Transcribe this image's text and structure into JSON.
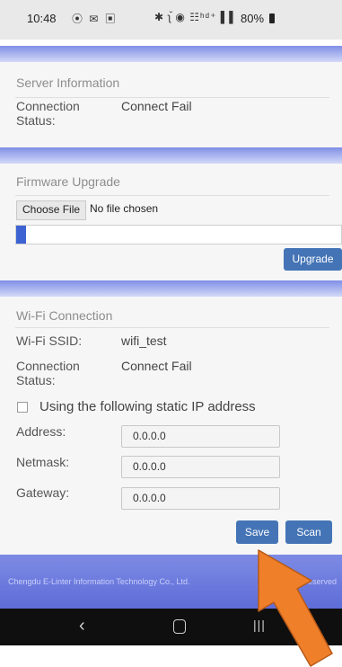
{
  "status_bar": {
    "time": "10:48",
    "left_icons": "⦿ ✉ ▣",
    "right_icons": "✱ ʅ̆ ◉ ☷ʰᵈ⁺ ▌▌",
    "battery": "80%"
  },
  "server": {
    "title": "Server Information",
    "conn_label_line1": "Connection",
    "conn_label_line2": "Status:",
    "conn_value": "Connect Fail"
  },
  "firmware": {
    "title": "Firmware Upgrade",
    "choose_file": "Choose File",
    "no_file": "No file chosen",
    "progress": 0.03,
    "upgrade_label": "Upgrade"
  },
  "wifi": {
    "title": "Wi-Fi Connection",
    "ssid_label": "Wi-Fi SSID:",
    "ssid_value": "wifi_test",
    "conn_label_line1": "Connection",
    "conn_label_line2": "Status:",
    "conn_value": "Connect Fail",
    "static_ip_label": "Using the following static IP address",
    "static_ip_checked": false,
    "address_label": "Address:",
    "address_value": "0.0.0.0",
    "netmask_label": "Netmask:",
    "netmask_value": "0.0.0.0",
    "gateway_label": "Gateway:",
    "gateway_value": "0.0.0.0",
    "save_label": "Save",
    "scan_label": "Scan"
  },
  "footer": {
    "text_left": "Chengdu E-Linter Information Technology Co., Ltd.",
    "text_right": "eserved"
  },
  "colors": {
    "accent": "#4474b6",
    "header_band": "#7f8fe6",
    "arrow": "#f07f2a"
  }
}
